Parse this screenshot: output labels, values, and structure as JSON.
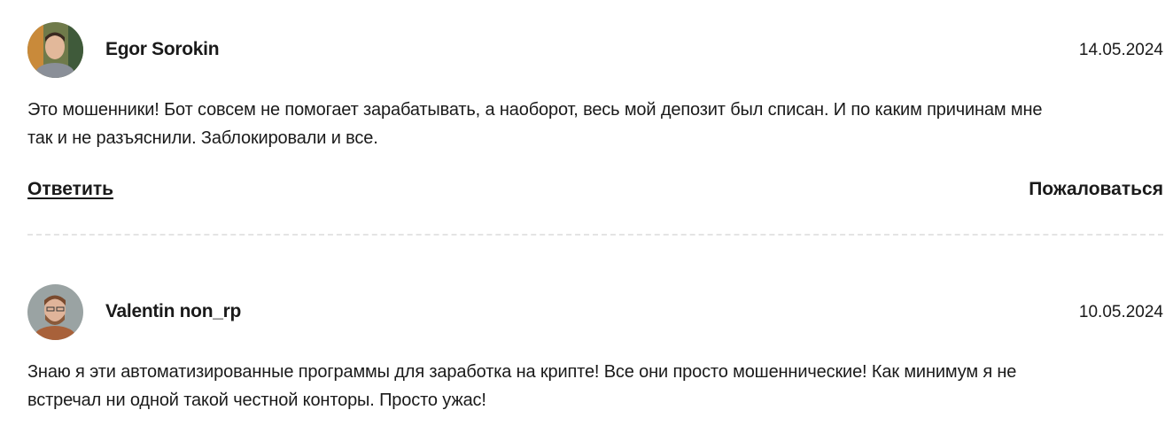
{
  "comments": [
    {
      "author": "Egor Sorokin",
      "date": "14.05.2024",
      "text_line1": "Это мошенники! Бот совсем не помогает зарабатывать, а наоборот, весь мой депозит был списан. И по каким причинам мне",
      "text_line2": "так и не разъяснили. Заблокировали и все.",
      "reply_label": "Ответить",
      "report_label": "Пожаловаться"
    },
    {
      "author": "Valentin non_rp",
      "date": "10.05.2024",
      "text_line1": "Знаю я эти автоматизированные программы для заработка на крипте! Все они просто мошеннические! Как минимум я не",
      "text_line2": "встречал ни одной такой честной конторы. Просто ужас!"
    }
  ]
}
